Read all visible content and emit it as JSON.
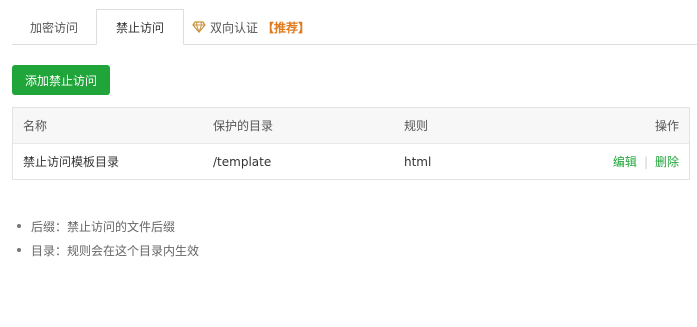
{
  "tabs": [
    {
      "label": "加密访问"
    },
    {
      "label": "禁止访问"
    },
    {
      "label": "双向认证",
      "badge": "【推荐】"
    }
  ],
  "add_button_label": "添加禁止访问",
  "table": {
    "headers": [
      "名称",
      "保护的目录",
      "规则",
      "操作"
    ],
    "rows": [
      {
        "name": "禁止访问模板目录",
        "dir": "/template",
        "rule": "html",
        "edit": "编辑",
        "delete": "删除"
      }
    ]
  },
  "notes": [
    "后缀：禁止访问的文件后缀",
    "目录：规则会在这个目录内生效"
  ],
  "colors": {
    "accent": "#20a53a",
    "recommend": "#e07b1f"
  }
}
